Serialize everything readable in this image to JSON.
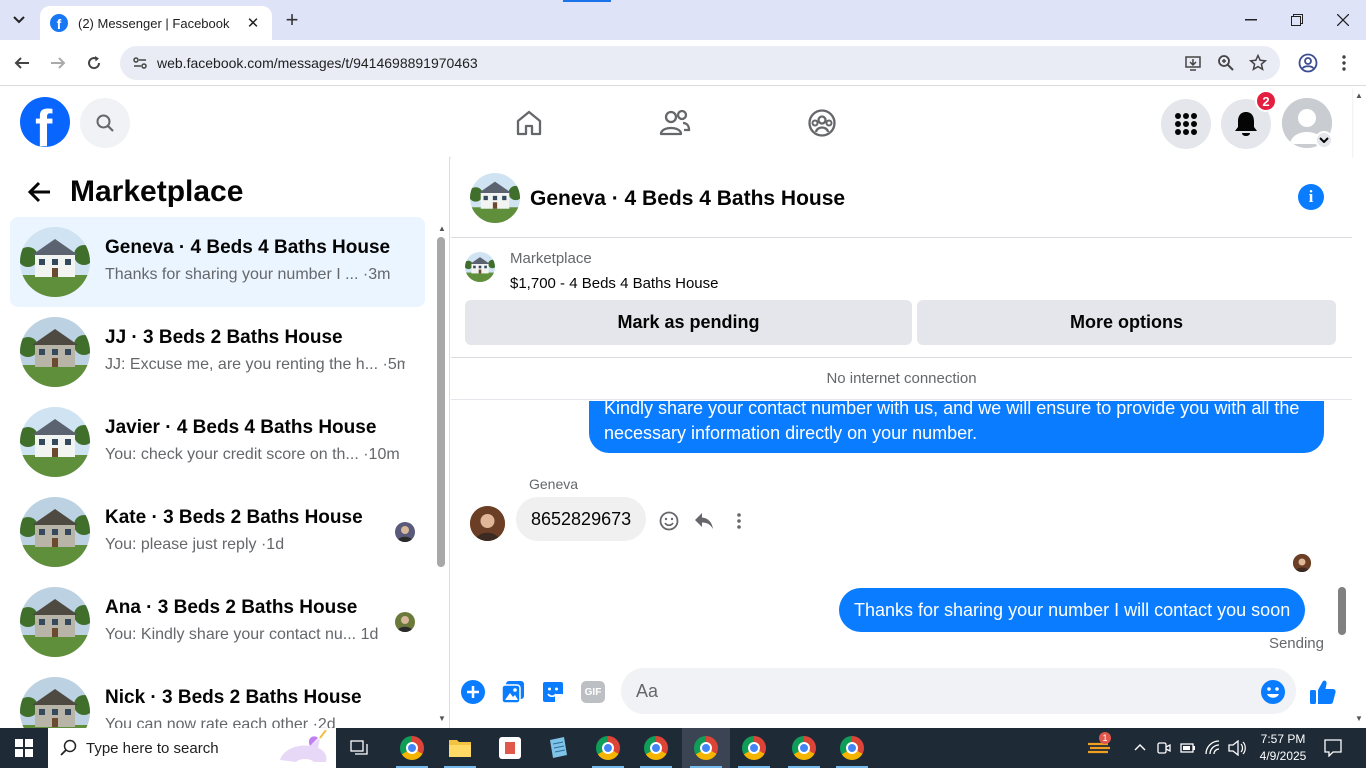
{
  "browser": {
    "tab_title": "(2) Messenger | Facebook",
    "new_tab_symbol": "+",
    "close_symbol": "✕",
    "url": "web.facebook.com/messages/t/9414698891970463"
  },
  "header": {
    "notification_count": "2",
    "logo_letter": "f"
  },
  "sidebar": {
    "title": "Marketplace",
    "conversations": [
      {
        "title": "Geneva · 4 Beds 4 Baths House",
        "preview": "Thanks for sharing your number I ...",
        "time": "·3m",
        "active": true,
        "house": "white"
      },
      {
        "title": "JJ · 3 Beds 2 Baths House",
        "preview": "JJ: Excuse me, are you renting the h...",
        "time": "·5m",
        "active": false,
        "house": "gray"
      },
      {
        "title": "Javier · 4 Beds 4 Baths House",
        "preview": "You: check your credit score on th...",
        "time": "·10m",
        "active": false,
        "house": "white"
      },
      {
        "title": "Kate · 3 Beds 2 Baths House",
        "preview": "You: please just reply",
        "time": "·1d",
        "active": false,
        "house": "gray"
      },
      {
        "title": "Ana · 3 Beds 2 Baths House",
        "preview": "You: Kindly share your contact nu...",
        "time": "1d",
        "active": false,
        "house": "gray"
      },
      {
        "title": "Nick · 3 Beds 2 Baths House",
        "preview": "You can now rate each other",
        "time": "·2d",
        "active": false,
        "house": "gray"
      }
    ]
  },
  "chat": {
    "title": "Geneva · 4 Beds 4 Baths House",
    "marketplace_label": "Marketplace",
    "listing": "$1,700 - 4 Beds 4 Baths House",
    "mark_pending_label": "Mark as pending",
    "more_options_label": "More options",
    "connection_status": "No internet connection",
    "messages": {
      "outgoing_1": "Kindly share your contact number with us, and we will ensure to provide you with all the necessary information directly on your number.",
      "sender_name": "Geneva",
      "incoming_1": "8652829673",
      "outgoing_2": "Thanks for sharing your number I will contact you soon",
      "status": "Sending"
    },
    "composer_placeholder": "Aa",
    "gif_label": "GIF"
  },
  "taskbar": {
    "search_placeholder": "Type here to search",
    "time": "7:57 PM",
    "date": "4/9/2025",
    "weather_badge": "1"
  },
  "colors": {
    "fb_blue": "#0866ff",
    "messenger_blue": "#0a7cff",
    "active_conv_bg": "#ebf5ff",
    "badge_red": "#e41e3f"
  }
}
